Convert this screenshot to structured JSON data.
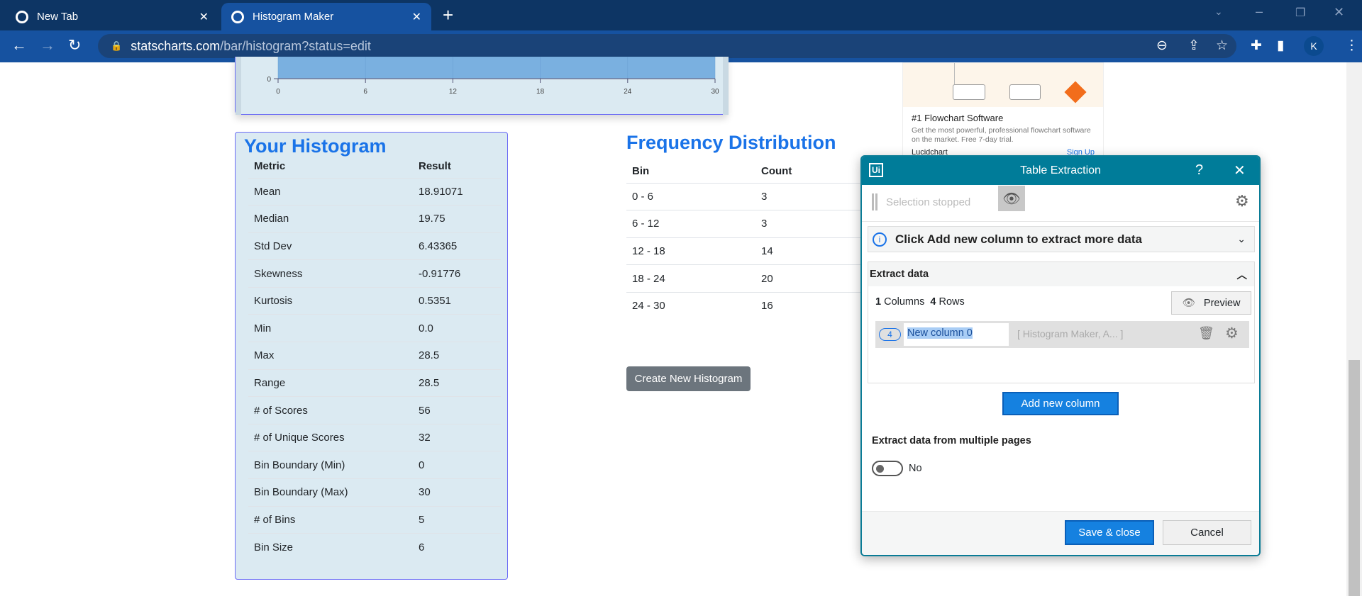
{
  "browser": {
    "tabs": [
      {
        "title": "New Tab",
        "active": false
      },
      {
        "title": "Histogram Maker",
        "active": true
      }
    ],
    "url_host": "statscharts.com",
    "url_path": "/bar/histogram?status=edit",
    "profile_initial": "K"
  },
  "chart_data": {
    "type": "bar",
    "x_ticks": [
      "0",
      "6",
      "12",
      "18",
      "24",
      "30"
    ],
    "y_ticks_visible": [
      "0"
    ],
    "categories": [
      "0 - 6",
      "6 - 12",
      "12 - 18",
      "18 - 24",
      "24 - 30"
    ],
    "values": [
      3,
      3,
      14,
      20,
      16
    ],
    "xlim": [
      0,
      30
    ],
    "bar_color": "#7ab0e0"
  },
  "summary": {
    "title": "Your Histogram",
    "headers": [
      "Metric",
      "Result"
    ],
    "rows": [
      [
        "Mean",
        "18.91071"
      ],
      [
        "Median",
        "19.75"
      ],
      [
        "Std Dev",
        "6.43365"
      ],
      [
        "Skewness",
        "-0.91776"
      ],
      [
        "Kurtosis",
        "0.5351"
      ],
      [
        "Min",
        "0.0"
      ],
      [
        "Max",
        "28.5"
      ],
      [
        "Range",
        "28.5"
      ],
      [
        "# of Scores",
        "56"
      ],
      [
        "# of Unique Scores",
        "32"
      ],
      [
        "Bin Boundary (Min)",
        "0"
      ],
      [
        "Bin Boundary (Max)",
        "30"
      ],
      [
        "# of Bins",
        "5"
      ],
      [
        "Bin Size",
        "6"
      ]
    ]
  },
  "frequency": {
    "title": "Frequency Distribution",
    "headers": [
      "Bin",
      "Count"
    ],
    "rows": [
      [
        "0 - 6",
        "3"
      ],
      [
        "6 - 12",
        "3"
      ],
      [
        "12 - 18",
        "14"
      ],
      [
        "18 - 24",
        "20"
      ],
      [
        "24 - 30",
        "16"
      ]
    ],
    "create_button": "Create New Histogram"
  },
  "ad": {
    "headline": "#1 Flowchart Software",
    "body": "Get the most powerful, professional flowchart software on the market. Free 7-day trial.",
    "brand": "Lucidchart",
    "cta": "Sign Up"
  },
  "dialog": {
    "logo": "Ui",
    "title": "Table Extraction",
    "help": "?",
    "selection_status": "Selection stopped",
    "banner": "Click Add new column to extract more data",
    "section_title": "Extract data",
    "columns_count": "1",
    "columns_label": "Columns",
    "rows_count": "4",
    "rows_label": "Rows",
    "preview": "Preview",
    "column": {
      "badge": "4",
      "name": "New column 0",
      "sample": "[ Histogram Maker, A... ]"
    },
    "add_column": "Add new column",
    "multi_pages_label": "Extract data from multiple pages",
    "toggle_label": "No",
    "toggle_on": false,
    "save": "Save & close",
    "cancel": "Cancel"
  }
}
